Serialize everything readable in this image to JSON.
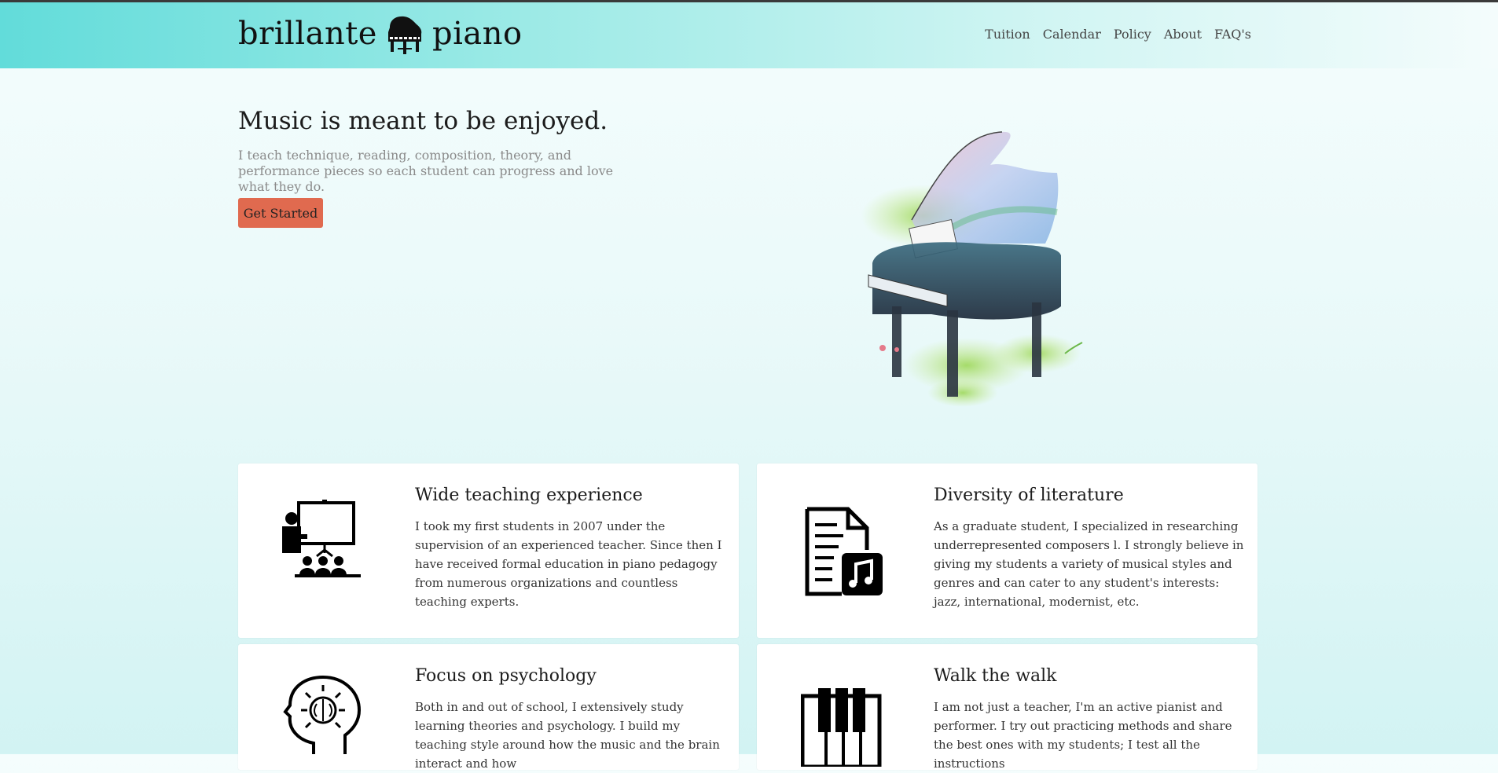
{
  "brand": {
    "word1": "brillante",
    "word2": "piano",
    "icon": "grand-piano-icon"
  },
  "nav": {
    "items": [
      "Tuition",
      "Calendar",
      "Policy",
      "About",
      "FAQ's"
    ]
  },
  "hero": {
    "title": "Music is meant to be enjoyed.",
    "subtitle": "I teach technique, reading, composition, theory, and performance pieces so each student can progress and love what they do.",
    "cta": "Get Started"
  },
  "features": [
    {
      "icon": "teacher-presentation-icon",
      "title": "Wide teaching experience",
      "text": "I took my first students in 2007 under the supervision of an experienced teacher. Since then I have received formal education in piano pedagogy from numerous organizations and countless teaching experts."
    },
    {
      "icon": "sheet-music-document-icon",
      "title": "Diversity of literature",
      "text": "As a graduate student, I specialized in researching underrepresented composers l. I strongly believe in giving my students a variety of musical styles and genres and can cater to any student's interests: jazz, international, modernist, etc."
    },
    {
      "icon": "brain-head-icon",
      "title": "Focus on psychology",
      "text": "Both in and out of school, I extensively study learning theories and psychology. I build my teaching style around how the music and the brain interact and how"
    },
    {
      "icon": "piano-keys-icon",
      "title": "Walk the walk",
      "text": "I am not just a teacher, I'm an active pianist and performer. I try out practicing methods and share the best ones with my students; I test all the instructions"
    }
  ],
  "colors": {
    "accent": "#e06a4f",
    "header_start": "#62dcda",
    "background": "#e9f9f9"
  }
}
